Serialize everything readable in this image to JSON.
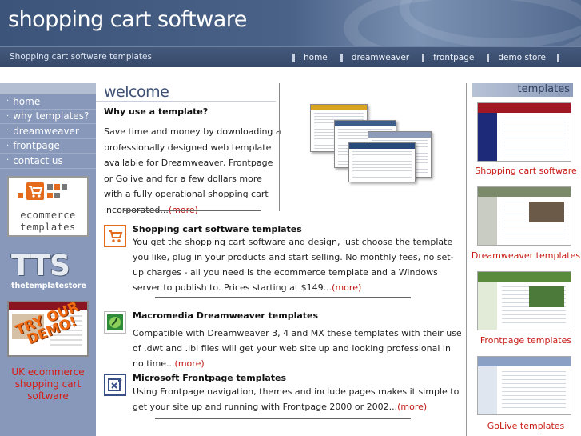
{
  "header": {
    "site_title": "shopping cart software",
    "subtitle": "Shopping cart software templates",
    "nav": [
      "home",
      "dreamweaver",
      "frontpage",
      "demo store"
    ]
  },
  "sidebar": {
    "items": [
      {
        "label": "home"
      },
      {
        "label": "why templates?"
      },
      {
        "label": "dreamweaver"
      },
      {
        "label": "frontpage"
      },
      {
        "label": "contact us"
      }
    ],
    "ecom_logo": {
      "line1": "ecommerce",
      "line2": "templates"
    },
    "tts_logo": {
      "big": "TTS",
      "small": "thetemplatestore"
    },
    "demo_badge": "TRY OUR DEMO!",
    "uk_link": "UK ecommerce shopping cart software"
  },
  "main": {
    "welcome": "welcome",
    "why_heading": "Why use a template?",
    "why_text": "Save time and money by downloading a professionally designed web template available for Dreamweaver, Frontpage or Golive and for a few dollars more with a fully operational shopping cart incorporated...",
    "more_label": "(more)",
    "sections": [
      {
        "icon": "shopping-cart-icon",
        "heading": "Shopping cart software templates",
        "text": "You get the shopping cart software and design, just choose the template you like, plug in your products and start selling. No monthly fees, no set-up charges - all you need is the ecommerce template and a Windows server to publish to. Prices starting at $149..."
      },
      {
        "icon": "dreamweaver-icon",
        "heading": "Macromedia Dreamweaver templates",
        "text": "Compatible with Dreamweaver 3, 4 and MX these templates with their use of .dwt and .lbi files will get your web site up and looking professional in no time..."
      },
      {
        "icon": "frontpage-icon",
        "heading": "Microsoft Frontpage templates",
        "text": "Using Frontpage navigation, themes and include pages makes it simple to get your site up and running with Frontpage 2000 or 2002..."
      }
    ]
  },
  "rightbar": {
    "header": "templates",
    "items": [
      {
        "label": "Shopping cart software",
        "hdr_color": "#a01824",
        "side_color": "#1d2a7a"
      },
      {
        "label": "Dreamweaver templates",
        "hdr_color": "#7c8a6c",
        "side_color": "#c9ccc2"
      },
      {
        "label": "Frontpage templates",
        "hdr_color": "#5a8a3c",
        "side_color": "#e2ead8"
      },
      {
        "label": "GoLive templates",
        "hdr_color": "#8aa0c4",
        "side_color": "#dfe6f0"
      }
    ]
  },
  "colors": {
    "header_blue": "#3c5479",
    "sidebar_blue": "#8798ba",
    "link_red": "#c01818",
    "icon_orange": "#e46a1c"
  }
}
